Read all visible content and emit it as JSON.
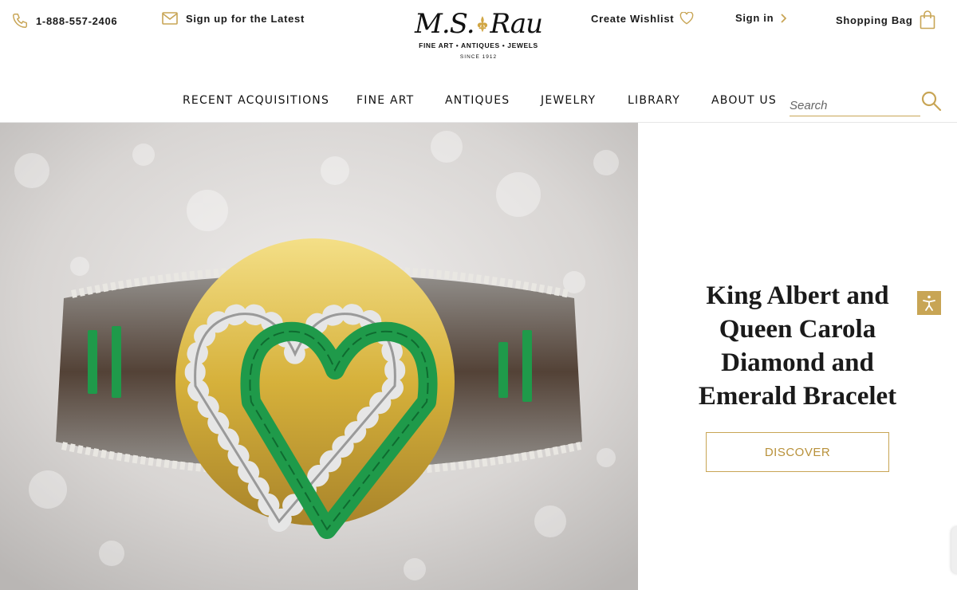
{
  "header": {
    "phone": "1-888-557-2406",
    "signup": "Sign up for the Latest",
    "wishlist": "Create Wishlist",
    "signin": "Sign in",
    "bag": "Shopping Bag"
  },
  "logo": {
    "mark_left": "M.S.",
    "mark_right": "Rau",
    "tagline": "FINE ART • ANTIQUES • JEWELS",
    "since": "SINCE 1912"
  },
  "nav": {
    "items": [
      "RECENT ACQUISITIONS",
      "FINE ART",
      "ANTIQUES",
      "JEWELRY",
      "LIBRARY",
      "ABOUT US"
    ]
  },
  "search": {
    "placeholder": "Search"
  },
  "hero": {
    "title": "King Albert and Queen Carola Diamond and Emerald Bracelet",
    "cta": "DISCOVER"
  },
  "colors": {
    "accent": "#c8a555",
    "cta_text": "#b8913a",
    "emerald": "#1f9a4a",
    "gold": "#d9b845"
  },
  "icons": [
    "phone-icon",
    "mail-icon",
    "heart-icon",
    "chevron-right-icon",
    "shopping-bag-icon",
    "search-icon",
    "accessibility-icon",
    "fleur-de-lis-icon"
  ]
}
